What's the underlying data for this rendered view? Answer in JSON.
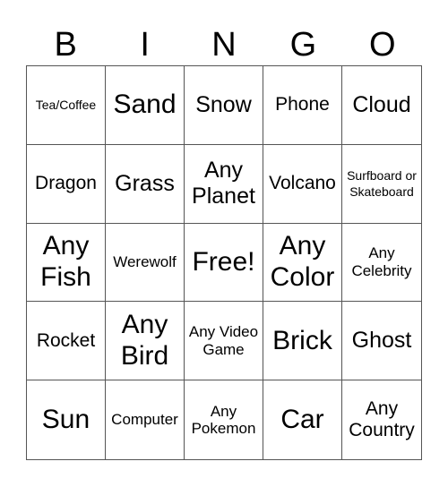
{
  "title_letters": [
    "B",
    "I",
    "N",
    "G",
    "O"
  ],
  "cells": [
    {
      "text": "Tea/Coffee",
      "size": "s-xs"
    },
    {
      "text": "Sand",
      "size": "s-xl"
    },
    {
      "text": "Snow",
      "size": "s-l"
    },
    {
      "text": "Phone",
      "size": "s-m"
    },
    {
      "text": "Cloud",
      "size": "s-l"
    },
    {
      "text": "Dragon",
      "size": "s-m"
    },
    {
      "text": "Grass",
      "size": "s-l"
    },
    {
      "text": "Any Planet",
      "size": "s-l"
    },
    {
      "text": "Volcano",
      "size": "s-m"
    },
    {
      "text": "Surfboard or Skateboard",
      "size": "s-xxs"
    },
    {
      "text": "Any Fish",
      "size": "s-xl"
    },
    {
      "text": "Werewolf",
      "size": "s-s"
    },
    {
      "text": "Free!",
      "size": "s-xl"
    },
    {
      "text": "Any Color",
      "size": "s-xl"
    },
    {
      "text": "Any Celebrity",
      "size": "s-s"
    },
    {
      "text": "Rocket",
      "size": "s-m"
    },
    {
      "text": "Any Bird",
      "size": "s-xl"
    },
    {
      "text": "Any Video Game",
      "size": "s-s"
    },
    {
      "text": "Brick",
      "size": "s-xl"
    },
    {
      "text": "Ghost",
      "size": "s-l"
    },
    {
      "text": "Sun",
      "size": "s-xl"
    },
    {
      "text": "Computer",
      "size": "s-s"
    },
    {
      "text": "Any Pokemon",
      "size": "s-s"
    },
    {
      "text": "Car",
      "size": "s-xl"
    },
    {
      "text": "Any Country",
      "size": "s-m"
    }
  ]
}
